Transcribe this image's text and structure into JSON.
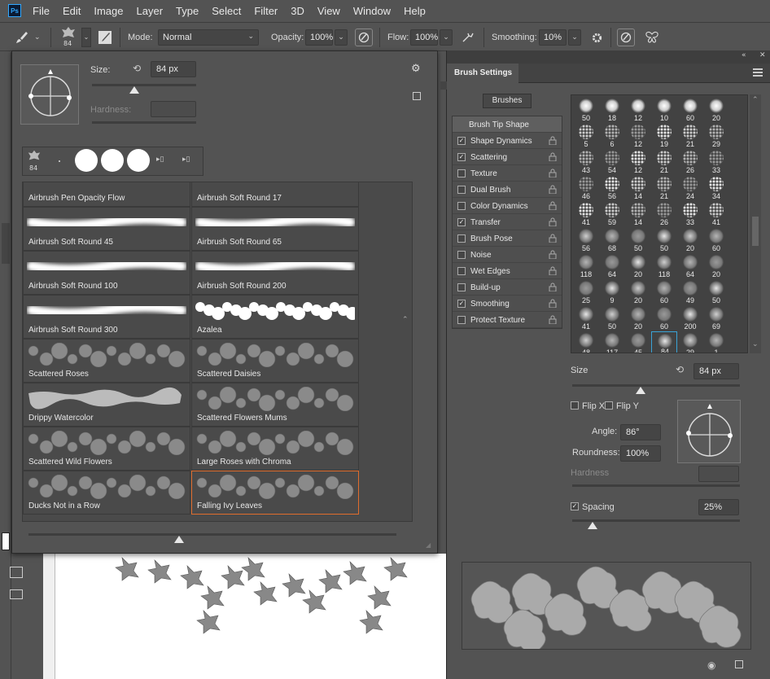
{
  "menu": {
    "logo": "Ps",
    "items": [
      "File",
      "Edit",
      "Image",
      "Layer",
      "Type",
      "Select",
      "Filter",
      "3D",
      "View",
      "Window",
      "Help"
    ]
  },
  "options_bar": {
    "brush_size": "84",
    "mode_label": "Mode:",
    "mode_value": "Normal",
    "opacity_label": "Opacity:",
    "opacity_value": "100%",
    "flow_label": "Flow:",
    "flow_value": "100%",
    "smoothing_label": "Smoothing:",
    "smoothing_value": "10%"
  },
  "picker": {
    "size_label": "Size:",
    "size_value": "84 px",
    "size_fraction": 0.41,
    "hardness_label": "Hardness:",
    "recent_brush_size": "84",
    "bottom_slider_fraction": 0.41,
    "brushes": [
      {
        "name": "Airbrush Pen Opacity Flow",
        "kind": "airbrush"
      },
      {
        "name": "Airbrush Soft Round 17",
        "kind": "soft"
      },
      {
        "name": "Airbrush Soft Round 45",
        "kind": "soft"
      },
      {
        "name": "Airbrush Soft Round 65",
        "kind": "soft"
      },
      {
        "name": "Airbrush Soft Round 100",
        "kind": "soft"
      },
      {
        "name": "Airbrush Soft Round 200",
        "kind": "soft"
      },
      {
        "name": "Airbrush Soft Round 300",
        "kind": "soft"
      },
      {
        "name": "Azalea",
        "kind": "flower"
      },
      {
        "name": "Scattered Roses",
        "kind": "texture"
      },
      {
        "name": "Scattered Daisies",
        "kind": "texture"
      },
      {
        "name": "Drippy Watercolor",
        "kind": "water"
      },
      {
        "name": "Scattered Flowers Mums",
        "kind": "texture"
      },
      {
        "name": "Scattered Wild Flowers",
        "kind": "texture"
      },
      {
        "name": "Large Roses with Chroma",
        "kind": "texture"
      },
      {
        "name": "Ducks Not in a Row",
        "kind": "texture"
      },
      {
        "name": "Falling Ivy Leaves",
        "kind": "texture",
        "selected": true
      }
    ]
  },
  "settings": {
    "title": "Brush Settings",
    "brushes_button": "Brushes",
    "options": [
      {
        "label": "Brush Tip Shape",
        "checked": null,
        "active": true
      },
      {
        "label": "Shape Dynamics",
        "checked": true
      },
      {
        "label": "Scattering",
        "checked": true
      },
      {
        "label": "Texture",
        "checked": false
      },
      {
        "label": "Dual Brush",
        "checked": false
      },
      {
        "label": "Color Dynamics",
        "checked": false
      },
      {
        "label": "Transfer",
        "checked": true
      },
      {
        "label": "Brush Pose",
        "checked": false
      },
      {
        "label": "Noise",
        "checked": false
      },
      {
        "label": "Wet Edges",
        "checked": false
      },
      {
        "label": "Build-up",
        "checked": false
      },
      {
        "label": "Smoothing",
        "checked": true
      },
      {
        "label": "Protect Texture",
        "checked": false
      }
    ],
    "tip_sizes": [
      [
        "50",
        "18",
        "12",
        "10",
        "60",
        "20"
      ],
      [
        "5",
        "6",
        "12",
        "19",
        "21",
        "29"
      ],
      [
        "43",
        "54",
        "12",
        "21",
        "26",
        "33"
      ],
      [
        "46",
        "56",
        "14",
        "21",
        "24",
        "34"
      ],
      [
        "41",
        "59",
        "14",
        "26",
        "33",
        "41"
      ],
      [
        "56",
        "68",
        "50",
        "50",
        "20",
        "60"
      ],
      [
        "118",
        "64",
        "20",
        "118",
        "64",
        "20"
      ],
      [
        "25",
        "9",
        "20",
        "60",
        "49",
        "50"
      ],
      [
        "41",
        "50",
        "20",
        "60",
        "200",
        "69"
      ],
      [
        "48",
        "117",
        "45",
        "84",
        "29",
        "1"
      ]
    ],
    "selected_tip": "84",
    "size_label": "Size",
    "size_value": "84 px",
    "size_fraction": 0.41,
    "flip_x": "Flip X",
    "flip_y": "Flip Y",
    "angle_label": "Angle:",
    "angle_value": "86°",
    "roundness_label": "Roundness:",
    "roundness_value": "100%",
    "hardness_label": "Hardness",
    "spacing_label": "Spacing",
    "spacing_checked": true,
    "spacing_value": "25%",
    "spacing_fraction": 0.12
  }
}
